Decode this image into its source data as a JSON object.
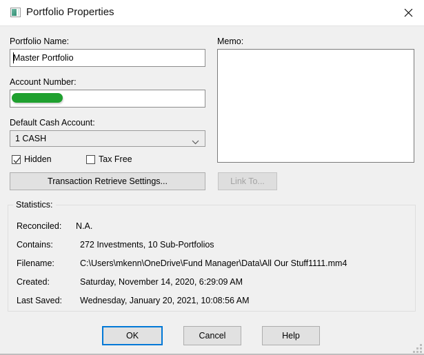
{
  "window": {
    "title": "Portfolio Properties",
    "icon": "portfolio-icon",
    "close_label": "close-icon"
  },
  "form": {
    "portfolio_name_label": "Portfolio Name:",
    "portfolio_name_value": "Master Portfolio",
    "portfolio_name_placeholder": "",
    "account_number_label": "Account Number:",
    "account_number_value": "",
    "account_number_redacted": true,
    "account_number_redaction_color": "#1fa02f",
    "default_cash_account_label": "Default Cash Account:",
    "default_cash_account_value": "1 CASH",
    "default_cash_account_options": [
      "1 CASH"
    ],
    "hidden_label": "Hidden",
    "hidden_checked": true,
    "tax_free_label": "Tax Free",
    "tax_free_checked": false,
    "transaction_retrieve_label": "Transaction Retrieve Settings...",
    "memo_label": "Memo:",
    "memo_value": "",
    "memo_placeholder": "",
    "link_to_label": "Link To...",
    "link_to_enabled": false
  },
  "statistics": {
    "group_title": "Statistics:",
    "rows": [
      {
        "key": "Reconciled:",
        "value": "N.A."
      },
      {
        "key": "Contains:",
        "value": "272 Investments, 10 Sub-Portfolios"
      },
      {
        "key": "Filename:",
        "value": "C:\\Users\\mkenn\\OneDrive\\Fund Manager\\Data\\All Our Stuff1111.mm4"
      },
      {
        "key": "Created:",
        "value": "Saturday, November 14, 2020, 6:29:09 AM"
      },
      {
        "key": "Last Saved:",
        "value": "Wednesday, January 20, 2021, 10:08:56 AM"
      }
    ]
  },
  "footer": {
    "ok_label": "OK",
    "cancel_label": "Cancel",
    "help_label": "Help",
    "default_button": "OK"
  },
  "colors": {
    "dialog_background": "#f0f0f0",
    "titlebar_background": "#ffffff",
    "accent_focus": "#0078d7",
    "redaction_green": "#1fa02f"
  }
}
